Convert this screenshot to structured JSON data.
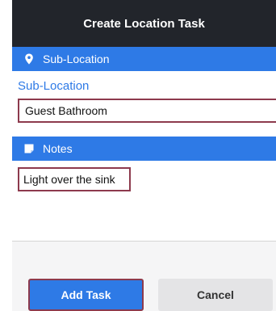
{
  "header": {
    "title": "Create Location Task"
  },
  "sublocation_section": {
    "title": "Sub-Location",
    "icon": "map-pin-icon"
  },
  "sublocation_field": {
    "label": "Sub-Location",
    "value": "Guest Bathroom"
  },
  "notes_section": {
    "title": "Notes",
    "icon": "note-icon"
  },
  "notes_field": {
    "value": "Light over the sink"
  },
  "buttons": {
    "primary": "Add Task",
    "secondary": "Cancel"
  },
  "colors": {
    "accent": "#2e7ae6",
    "header_bg": "#22252b",
    "highlight_border": "#8d3a4d",
    "secondary_button": "#e4e4e6"
  }
}
